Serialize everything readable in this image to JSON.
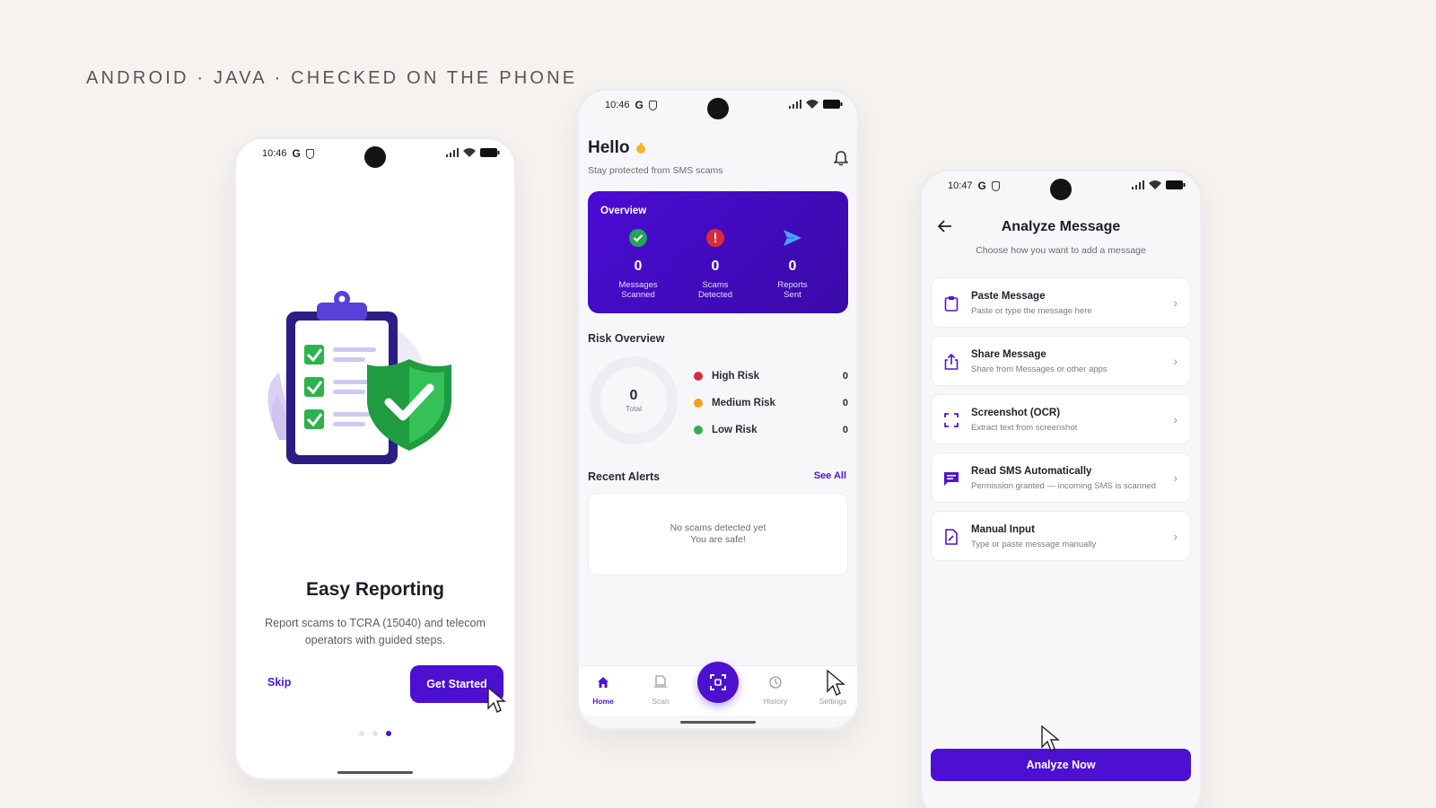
{
  "caption": "ANDROID · JAVA · CHECKED ON THE PHONE",
  "colors": {
    "accent": "#4d0fd0",
    "high_risk": "#d72c3c",
    "medium_risk": "#f0a11c",
    "low_risk": "#2fb14f",
    "success": "#23a559"
  },
  "phone1": {
    "status": {
      "time": "10:46",
      "g": "G"
    },
    "title": "Easy Reporting",
    "description": "Report scams to TCRA (15040) and telecom operators with guided steps.",
    "skip_label": "Skip",
    "get_started_label": "Get Started",
    "pager": {
      "count": 3,
      "active": 3
    }
  },
  "phone2": {
    "status": {
      "time": "10:46",
      "g": "G"
    },
    "greeting": "Hello",
    "subtitle": "Stay protected from SMS scams",
    "overview": {
      "title": "Overview",
      "stats": [
        {
          "value": "0",
          "label1": "Messages",
          "label2": "Scanned",
          "icon": "check-circle-icon"
        },
        {
          "value": "0",
          "label1": "Scams",
          "label2": "Detected",
          "icon": "alert-circle-icon"
        },
        {
          "value": "0",
          "label1": "Reports",
          "label2": "Sent",
          "icon": "send-icon"
        }
      ]
    },
    "risk_overview": {
      "title": "Risk Overview",
      "total_value": "0",
      "total_label": "Total",
      "rows": [
        {
          "label": "High Risk",
          "value": "0"
        },
        {
          "label": "Medium Risk",
          "value": "0"
        },
        {
          "label": "Low Risk",
          "value": "0"
        }
      ]
    },
    "recent_alerts": {
      "title": "Recent Alerts",
      "see_all": "See All",
      "empty_line1": "No scams detected yet",
      "empty_line2": "You are safe!"
    },
    "nav": {
      "home": "Home",
      "scan": "Scan",
      "history": "History",
      "settings": "Settings"
    }
  },
  "phone3": {
    "status": {
      "time": "10:47",
      "g": "G"
    },
    "title": "Analyze Message",
    "subtitle": "Choose how you want to add a message",
    "options": [
      {
        "title": "Paste Message",
        "subtitle": "Paste or type the message here",
        "icon": "clipboard-icon"
      },
      {
        "title": "Share Message",
        "subtitle": "Share from Messages or other apps",
        "icon": "share-icon"
      },
      {
        "title": "Screenshot (OCR)",
        "subtitle": "Extract text from screenshot",
        "icon": "scan-frame-icon"
      },
      {
        "title": "Read SMS Automatically",
        "subtitle": "Permission granted — incoming SMS is scanned",
        "icon": "sms-icon"
      },
      {
        "title": "Manual Input",
        "subtitle": "Type or paste message manually",
        "icon": "document-edit-icon"
      }
    ],
    "analyze_label": "Analyze Now"
  }
}
